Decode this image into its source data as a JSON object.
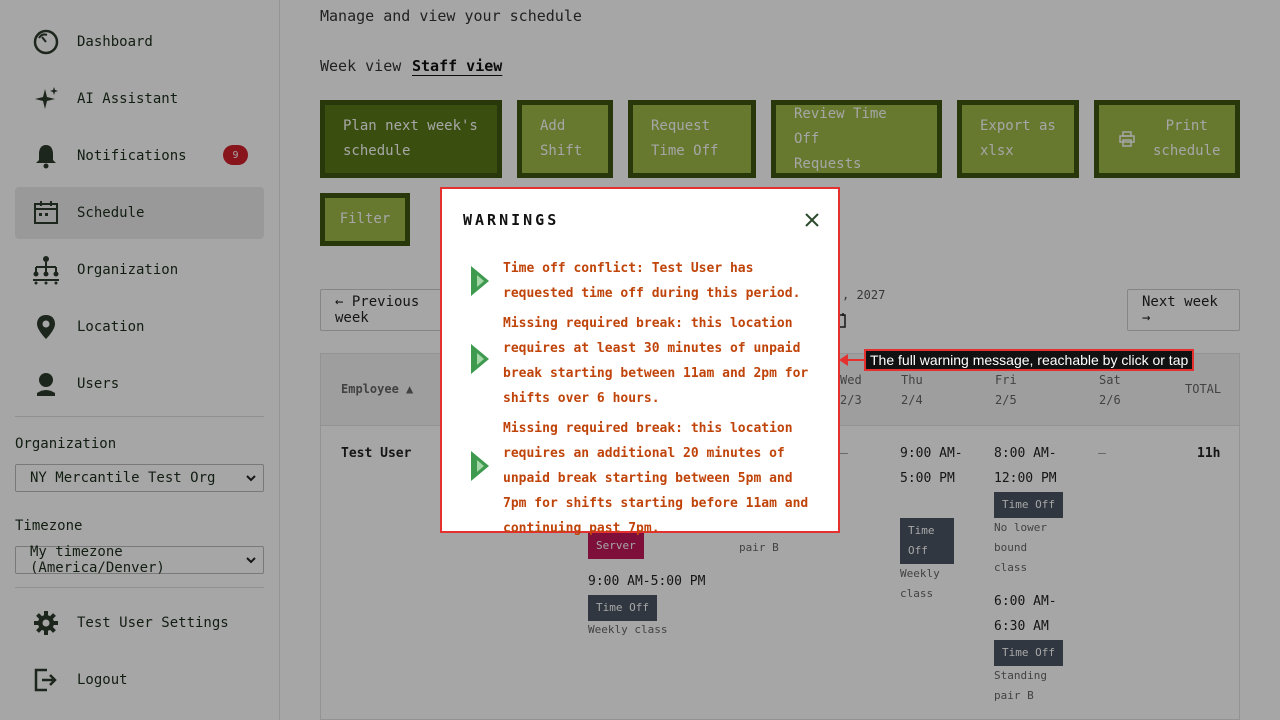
{
  "sidebar": {
    "items": [
      {
        "label": "Dashboard",
        "icon": "dashboard-icon"
      },
      {
        "label": "AI Assistant",
        "icon": "sparkle-icon"
      },
      {
        "label": "Notifications",
        "icon": "bell-icon",
        "badge": "9"
      },
      {
        "label": "Schedule",
        "icon": "calendar-icon",
        "active": true
      },
      {
        "label": "Organization",
        "icon": "org-chart-icon"
      },
      {
        "label": "Location",
        "icon": "location-pin-icon"
      },
      {
        "label": "Users",
        "icon": "user-icon"
      }
    ],
    "organization_label": "Organization",
    "organization_value": "NY Mercantile Test Org",
    "timezone_label": "Timezone",
    "timezone_value": "My timezone (America/Denver)",
    "settings_label": "Test User Settings",
    "logout_label": "Logout"
  },
  "header": {
    "subtitle": "Manage and view your schedule",
    "tabs": [
      "Week view",
      "Staff view"
    ],
    "active_tab": "Staff view"
  },
  "actions": {
    "plan_next_week": "Plan next week's\nschedule",
    "add_shift": "Add\nShift",
    "request_time_off": "Request\nTime Off",
    "review_time_off": "Review Time Off\nRequests",
    "export_xlsx": "Export as\nxlsx",
    "print_schedule": "Print\nschedule",
    "filter": "Filter"
  },
  "week_nav": {
    "previous": "← Previous week",
    "next": "Next week →",
    "date_fragment": ", 2027"
  },
  "table": {
    "headers": {
      "employee": "Employee ▲",
      "wed": "Wed",
      "wed_date": "2/3",
      "thu": "Thu",
      "thu_date": "2/4",
      "fri": "Fri",
      "fri_date": "2/5",
      "sat": "Sat",
      "sat_date": "2/6",
      "total": "TOTAL"
    },
    "row": {
      "employee": "Test User",
      "wed_dash": "–",
      "thu_shift": "9:00 AM-5:00 PM",
      "thu_tag": "Time Off",
      "thu_note": "Weekly class",
      "fri_shift1": "8:00 AM-12:00 PM",
      "fri_tag1": "Time Off",
      "fri_note1": "No lower bound class",
      "fri_shift2": "6:00 AM-6:30 AM",
      "fri_tag2": "Time Off",
      "fri_note2": "Standing pair B",
      "sat_dash": "–",
      "total": "11h",
      "tue_server_tag": "Server",
      "tue_shift": "9:00 AM-5:00 PM",
      "tue_tag": "Time Off",
      "tue_note": "Weekly class",
      "mon_note": "pair B"
    }
  },
  "modal": {
    "title": "WARNINGS",
    "warnings": [
      "Time off conflict: Test User has requested time off during this period.",
      "Missing required break: this location requires at least 30 minutes of unpaid break starting between 11am and 2pm for shifts over 6 hours.",
      "Missing required break: this location requires an additional 20 minutes of unpaid break starting between 5pm and 7pm for shifts starting before 11am and continuing past 7pm."
    ]
  },
  "annotation": {
    "text": "The full warning message, reachable by click or tap"
  },
  "colors": {
    "button_bg": "#9fba47",
    "button_border": "#3f5612",
    "warning_text": "#c0440a",
    "badge": "#d21f2c",
    "annotation_border": "#e53030"
  }
}
